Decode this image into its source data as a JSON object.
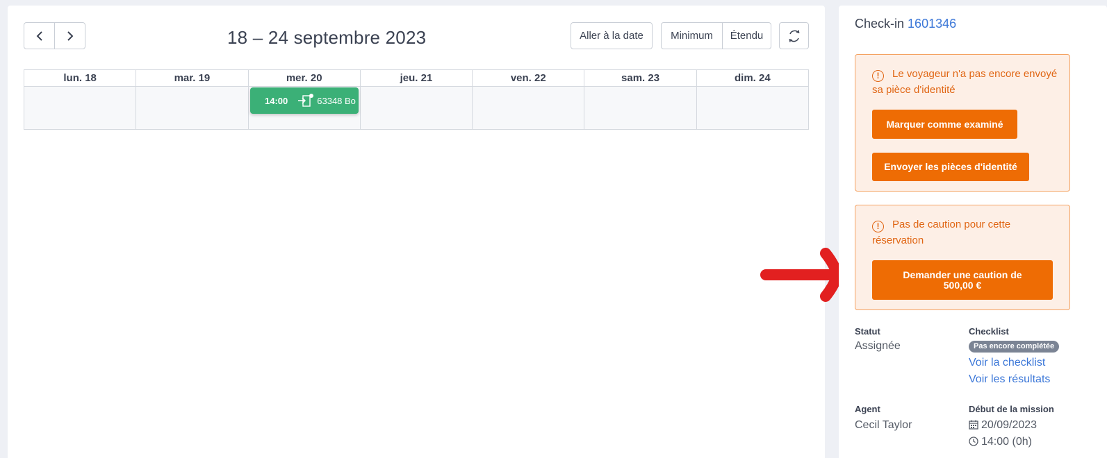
{
  "calendar": {
    "title": "18 – 24 septembre 2023",
    "prev_icon": "chevron-left-icon",
    "next_icon": "chevron-right-icon",
    "goto_label": "Aller à la date",
    "min_label": "Minimum",
    "ext_label": "Étendu",
    "refresh_icon": "refresh-icon",
    "days": [
      "lun. 18",
      "mar. 19",
      "mer. 20",
      "jeu. 21",
      "ven. 22",
      "sam. 23",
      "dim. 24"
    ],
    "event": {
      "time": "14:00",
      "icon": "checkin-door-icon",
      "ref": "63348 Bo",
      "color": "#3bb077"
    }
  },
  "side": {
    "title_prefix": "Check-in",
    "title_id": "1601346",
    "alerts": [
      {
        "icon": "warning-circle-icon",
        "text": "Le voyageur n'a pas encore envoyé sa pièce d'identité",
        "buttons": [
          "Marquer comme examiné",
          "Envoyer les pièces d'identité"
        ]
      },
      {
        "icon": "warning-circle-icon",
        "text": "Pas de caution pour cette réservation",
        "buttons": [
          "Demander une caution de 500,00 €"
        ]
      }
    ],
    "statut_label": "Statut",
    "statut_value": "Assignée",
    "checklist_label": "Checklist",
    "checklist_badge": "Pas encore complétée",
    "checklist_link": "Voir la checklist",
    "results_link": "Voir les résultats",
    "agent_label": "Agent",
    "agent_value": "Cecil Taylor",
    "start_label": "Début de la mission",
    "start_date": "20/09/2023",
    "start_time": "14:00 (0h)",
    "accent_color": "#ee6c04",
    "link_color": "#3d78d8"
  }
}
